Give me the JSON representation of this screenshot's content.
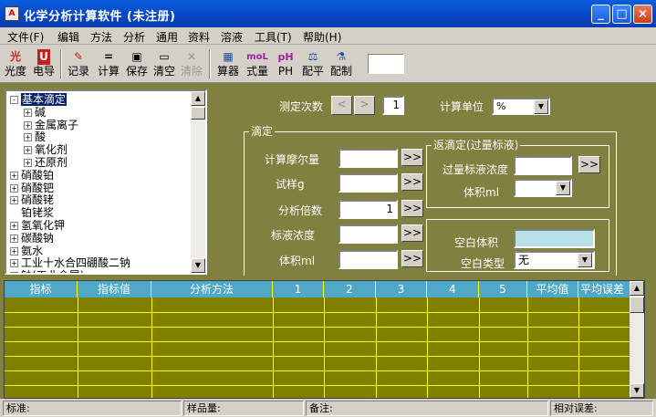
{
  "title": "化学分析计算软件 (未注册)",
  "menu": [
    "文件(F)",
    "编辑",
    "方法",
    "分析",
    "通用",
    "资料",
    "溶液",
    "工具(T)",
    "帮助(H)"
  ],
  "toolbar": [
    {
      "label": "光度",
      "icon": "光"
    },
    {
      "label": "电导",
      "icon": "U"
    },
    {
      "label": "记录",
      "icon": "✎"
    },
    {
      "label": "计算",
      "icon": "="
    },
    {
      "label": "保存",
      "icon": "▣"
    },
    {
      "label": "清空",
      "icon": "▭"
    },
    {
      "label": "清除",
      "icon": "✕"
    },
    {
      "label": "算器",
      "icon": "▦"
    },
    {
      "label": "式量",
      "icon": "moL"
    },
    {
      "label": "PH",
      "icon": "pH"
    },
    {
      "label": "配平",
      "icon": "⚖"
    },
    {
      "label": "配制",
      "icon": "⚗"
    }
  ],
  "tree": [
    {
      "label": "基本滴定",
      "level": 0,
      "toggle": "-",
      "selected": true
    },
    {
      "label": "碱",
      "level": 1,
      "toggle": "+"
    },
    {
      "label": "金属离子",
      "level": 1,
      "toggle": "+"
    },
    {
      "label": "酸",
      "level": 1,
      "toggle": "+"
    },
    {
      "label": "氧化剂",
      "level": 1,
      "toggle": "+"
    },
    {
      "label": "还原剂",
      "level": 1,
      "toggle": "+"
    },
    {
      "label": "硝酸铂",
      "level": 0,
      "toggle": "+"
    },
    {
      "label": "硝酸钯",
      "level": 0,
      "toggle": "+"
    },
    {
      "label": "硝酸铑",
      "level": 0,
      "toggle": "+"
    },
    {
      "label": "铂铑浆",
      "level": 0,
      "toggle": ""
    },
    {
      "label": "氢氧化钾",
      "level": 0,
      "toggle": "+"
    },
    {
      "label": "碳酸钠",
      "level": 0,
      "toggle": "+"
    },
    {
      "label": "氨水",
      "level": 0,
      "toggle": "+"
    },
    {
      "label": "工业十水合四硼酸二钠",
      "level": 0,
      "toggle": "+"
    },
    {
      "label": "钠(工业金属)",
      "level": 0,
      "toggle": "+"
    }
  ],
  "form": {
    "count_label": "测定次数",
    "count_value": "1",
    "unit_label": "计算单位",
    "unit_value": "%",
    "titration_group": "滴定",
    "molar_label": "计算摩尔量",
    "sample_label": "试样g",
    "factor_label": "分析倍数",
    "factor_value": "1",
    "std_conc_label": "标液浓度",
    "volume_label": "体积ml",
    "back_group": "返滴定(过量标液)",
    "excess_conc_label": "过量标液浓度",
    "back_volume_label": "体积ml",
    "blank_volume_label": "空白体积",
    "blank_type_label": "空白类型",
    "blank_type_value": "无",
    "arrow": ">>"
  },
  "grid_headers": [
    "指标",
    "指标值",
    "分析方法",
    "1",
    "2",
    "3",
    "4",
    "5",
    "平均值",
    "平均误差"
  ],
  "status": [
    "标准:",
    "样品量:",
    "备注:",
    "相对误差:"
  ],
  "colors": {
    "panel": "#808040",
    "grid_header": "#4fa8c8",
    "grid_bg": "#808000",
    "grid_line": "#ffff00",
    "title_bar": "#0a5fe0",
    "blank_input": "#b8e0e8"
  }
}
